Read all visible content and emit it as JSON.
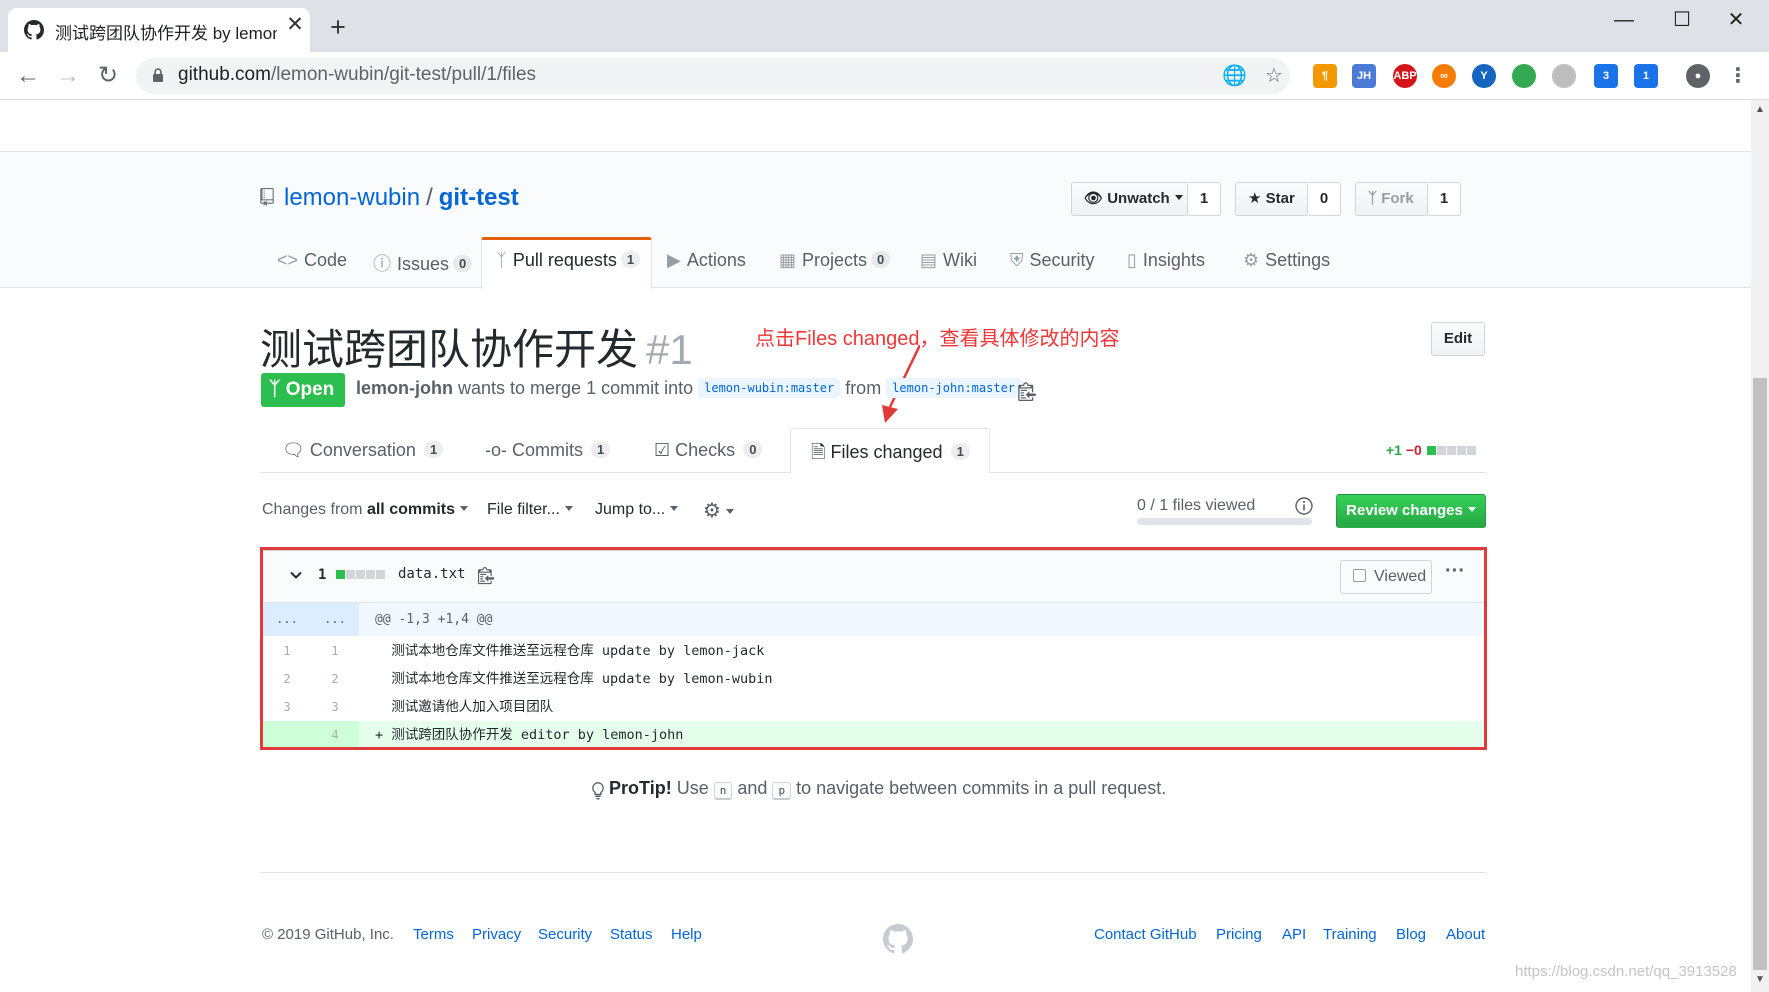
{
  "browser": {
    "tab_title": "测试跨团队协作开发 by lemon-j",
    "tab_close": "✕",
    "new_tab": "+",
    "url_host": "github.com",
    "url_path": "/lemon-wubin/git-test/pull/1/files",
    "extensions": [
      {
        "name": "translate-icon",
        "color": "#5f6368",
        "text": ""
      },
      {
        "name": "star-bookmark-icon",
        "color": "#5f6368",
        "text": ""
      },
      {
        "name": "paragraph-extension-icon",
        "color": "#f29900",
        "text": "¶"
      },
      {
        "name": "jh-extension-icon",
        "color": "#4a7bd8",
        "text": "JH"
      },
      {
        "name": "adblock-plus-icon",
        "color": "#d4161b",
        "text": "ABP"
      },
      {
        "name": "infinity-extension-icon",
        "color": "#f57c00",
        "text": "∞"
      },
      {
        "name": "y-extension-icon",
        "color": "#1565c0",
        "text": "Y"
      },
      {
        "name": "green-circle-extension-icon",
        "color": "#34a853",
        "text": ""
      },
      {
        "name": "gray-extension-icon",
        "color": "#bdbdbd",
        "text": ""
      },
      {
        "name": "badge-3-extension-icon",
        "color": "#1a73e8",
        "text": "3"
      },
      {
        "name": "badge-1-extension-icon",
        "color": "#1a73e8",
        "text": "1"
      }
    ]
  },
  "repo": {
    "owner": "lemon-wubin",
    "separator": "/",
    "name": "git-test",
    "unwatch_label": "Unwatch",
    "unwatch_count": "1",
    "star_label": "Star",
    "star_count": "0",
    "fork_label": "Fork",
    "fork_count": "1"
  },
  "reponav": {
    "code": "Code",
    "issues": "Issues",
    "issues_count": "0",
    "pull_requests": "Pull requests",
    "pull_requests_count": "1",
    "actions": "Actions",
    "projects": "Projects",
    "projects_count": "0",
    "wiki": "Wiki",
    "security": "Security",
    "insights": "Insights",
    "settings": "Settings"
  },
  "pr": {
    "title": "测试跨团队协作开发",
    "number": "#1",
    "edit_label": "Edit",
    "state": "Open",
    "author": "lemon-john",
    "action_text": "wants to merge 1 commit into",
    "base_branch": "lemon-wubin:master",
    "from_text": "from",
    "head_branch": "lemon-john:master",
    "annotation": "点击Files changed，查看具体修改的内容"
  },
  "tabs": {
    "conversation": "Conversation",
    "conversation_count": "1",
    "commits": "Commits",
    "commits_count": "1",
    "checks": "Checks",
    "checks_count": "0",
    "files_changed": "Files changed",
    "files_changed_count": "1",
    "diffstat_add": "+1",
    "diffstat_del": "−0"
  },
  "toolbar": {
    "changes_from": "Changes from",
    "all_commits": "all commits",
    "file_filter": "File filter...",
    "jump_to": "Jump to...",
    "files_viewed": "0 / 1 files viewed",
    "review_changes": "Review changes"
  },
  "file": {
    "changes_count": "1",
    "name": "data.txt",
    "viewed_label": "Viewed",
    "menu": "···",
    "hunk_left": "...",
    "hunk_right": "...",
    "hunk_header": "@@ -1,3 +1,4 @@",
    "lines": [
      {
        "old": "1",
        "new": "1",
        "text": "  测试本地仓库文件推送至远程仓库 update by lemon-jack"
      },
      {
        "old": "2",
        "new": "2",
        "text": "  测试本地仓库文件推送至远程仓库 update by lemon-wubin"
      },
      {
        "old": "3",
        "new": "3",
        "text": "  测试邀请他人加入项目团队"
      },
      {
        "old": "",
        "new": "4",
        "text": "+ 测试跨团队协作开发 editor by lemon-john"
      }
    ]
  },
  "protip": {
    "label": "ProTip!",
    "use": "Use",
    "key_n": "n",
    "and": "and",
    "key_p": "p",
    "rest": "to navigate between commits in a pull request."
  },
  "footer": {
    "copyright": "© 2019 GitHub, Inc.",
    "left_links": [
      "Terms",
      "Privacy",
      "Security",
      "Status",
      "Help"
    ],
    "right_links": [
      "Contact GitHub",
      "Pricing",
      "API",
      "Training",
      "Blog",
      "About"
    ]
  },
  "watermark": "https://blog.csdn.net/qq_3913528"
}
